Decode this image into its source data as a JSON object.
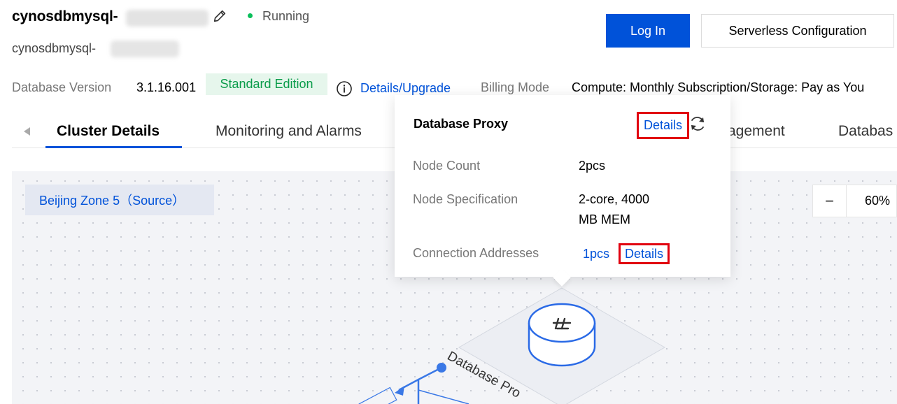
{
  "header": {
    "title": "cynosdbmysql-",
    "subtitle": "cynosdbmysql-",
    "status": "Running",
    "status_color": "#0abf5b",
    "login_label": "Log In",
    "serverless_label": "Serverless Configuration"
  },
  "info": {
    "version_label": "Database Version",
    "version_value": "3.1.16.001",
    "edition_badge": "Standard Edition",
    "upgrade_link": "Details/Upgrade",
    "billing_label": "Billing Mode",
    "billing_value": "Compute: Monthly Subscription/Storage: Pay as You"
  },
  "tabs": [
    {
      "label": "Cluster Details",
      "active": true
    },
    {
      "label": "Monitoring and Alarms"
    },
    {
      "label": "agement"
    },
    {
      "label": "Databas"
    }
  ],
  "canvas": {
    "zone_label": "Beijing Zone 5（Source）",
    "zoom_minus": "−",
    "zoom_value": "60%",
    "diagram_label": "Database Pro"
  },
  "popover": {
    "title": "Database Proxy",
    "details_label": "Details",
    "rows": [
      {
        "label": "Node Count",
        "value": "2pcs"
      },
      {
        "label": "Node Specification",
        "value_line1": "2-core, 4000",
        "value_line2": "MB MEM"
      },
      {
        "label": "Connection Addresses",
        "value": "1pcs",
        "link": "Details"
      }
    ]
  },
  "colors": {
    "accent": "#0052d9",
    "highlight": "#e1000f",
    "edition_bg": "#e6f6ec",
    "edition_fg": "#0a9c4a"
  }
}
